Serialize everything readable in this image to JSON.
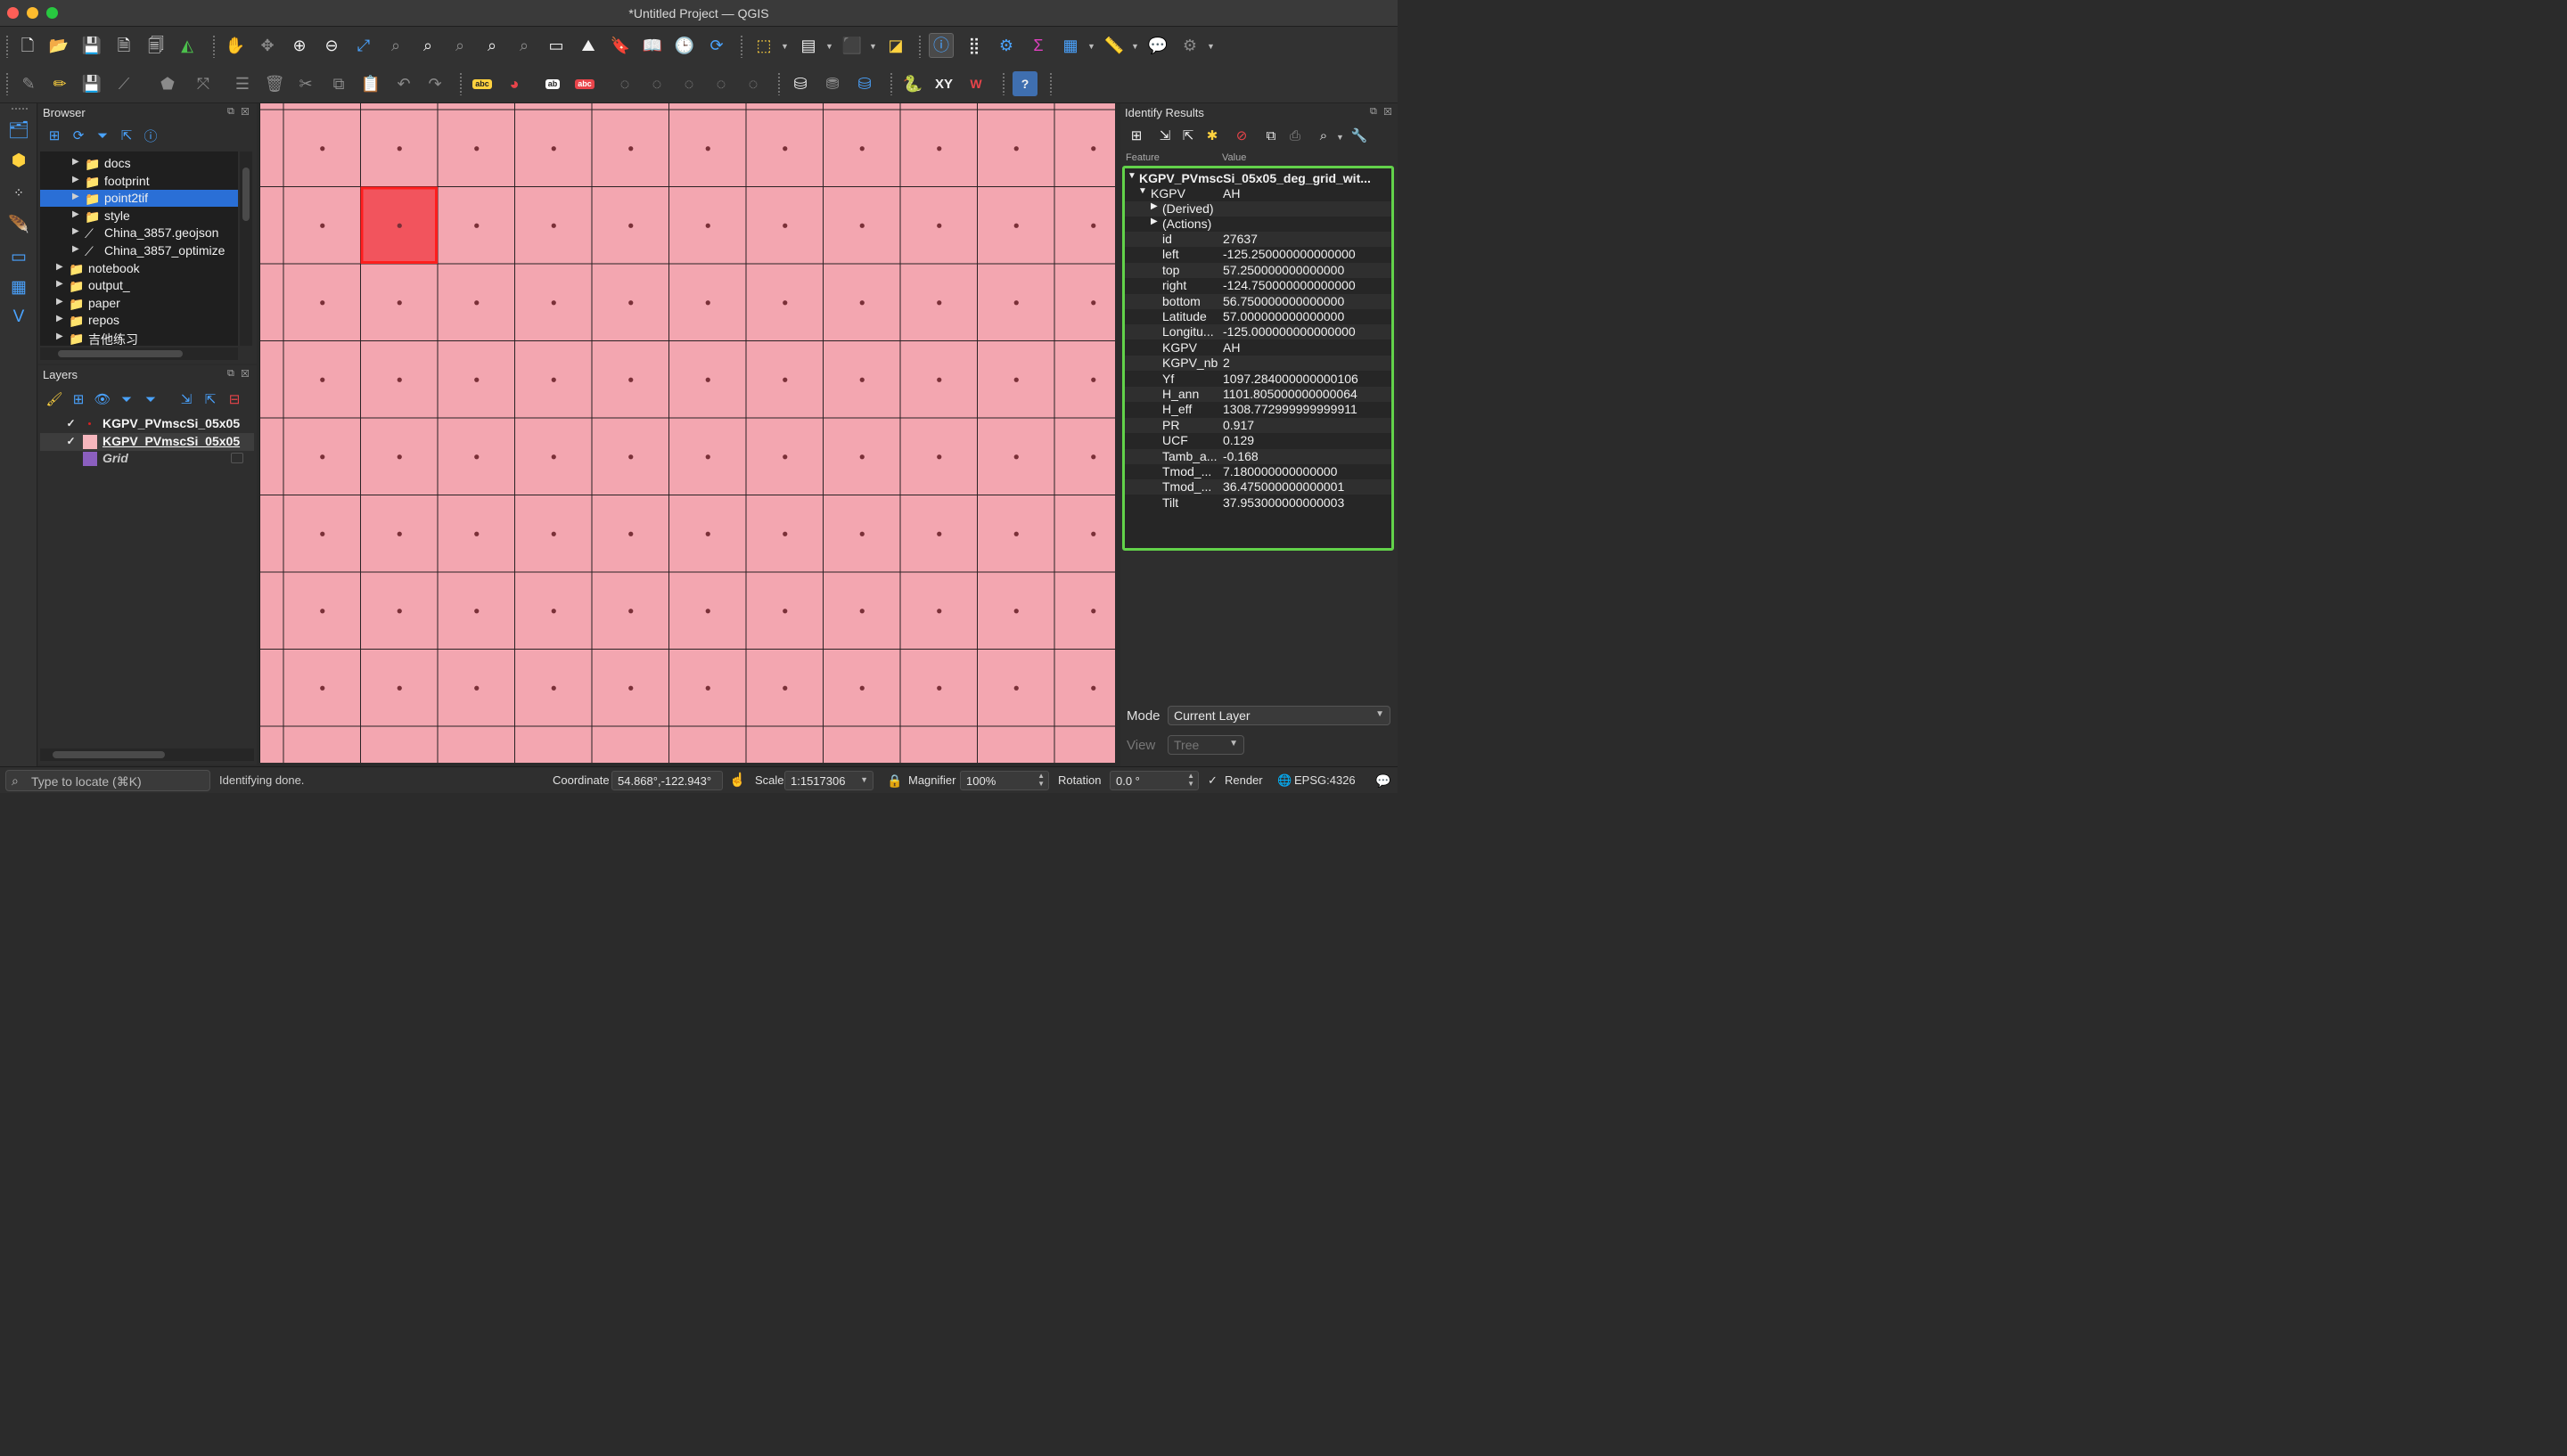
{
  "window": {
    "title": "*Untitled Project — QGIS"
  },
  "browser": {
    "title": "Browser",
    "items": [
      {
        "label": "docs",
        "icon": "folder-icon",
        "indent": 2,
        "selected": false
      },
      {
        "label": "footprint",
        "icon": "folder-icon",
        "indent": 2,
        "selected": false
      },
      {
        "label": "point2tif",
        "icon": "folder-icon",
        "indent": 2,
        "selected": true
      },
      {
        "label": "style",
        "icon": "folder-icon",
        "indent": 2,
        "selected": false
      },
      {
        "label": "China_3857.geojson",
        "icon": "vector-file-icon",
        "indent": 2,
        "selected": false
      },
      {
        "label": "China_3857_optimize",
        "icon": "vector-file-icon",
        "indent": 2,
        "selected": false
      },
      {
        "label": "notebook",
        "icon": "folder-icon",
        "indent": 1,
        "selected": false
      },
      {
        "label": "output_",
        "icon": "folder-icon",
        "indent": 1,
        "selected": false
      },
      {
        "label": "paper",
        "icon": "folder-icon",
        "indent": 1,
        "selected": false
      },
      {
        "label": "repos",
        "icon": "folder-icon",
        "indent": 1,
        "selected": false
      },
      {
        "label": "吉他练习",
        "icon": "folder-icon",
        "indent": 1,
        "selected": false
      }
    ]
  },
  "layers": {
    "title": "Layers",
    "items": [
      {
        "label": "KGPV_PVmscSi_05x05",
        "checked": true,
        "swatch": "point",
        "color": "#d62020",
        "italic": false,
        "selected": false
      },
      {
        "label": "KGPV_PVmscSi_05x05",
        "checked": true,
        "swatch": "polygon",
        "color": "#f5b6bd",
        "italic": false,
        "selected": true
      },
      {
        "label": "Grid",
        "checked": false,
        "swatch": "polygon",
        "color": "#8b5fbf",
        "italic": true,
        "selected": false
      }
    ]
  },
  "map": {
    "fill_color": "#f3a6b0",
    "highlight_color": "#f2545d",
    "highlight_border": "#ff1e1e",
    "grid_rows": 9,
    "grid_cols": 11,
    "highlight_cell": {
      "row": 1,
      "col": 1
    }
  },
  "identify": {
    "title": "Identify Results",
    "col_feature": "Feature",
    "col_value": "Value",
    "root": "KGPV_PVmscSi_05x05_deg_grid_wit...",
    "feature_key": "KGPV",
    "feature_value": "AH",
    "derived": "(Derived)",
    "actions": "(Actions)",
    "attributes": [
      {
        "key": "id",
        "value": "27637"
      },
      {
        "key": "left",
        "value": "-125.250000000000000"
      },
      {
        "key": "top",
        "value": "57.250000000000000"
      },
      {
        "key": "right",
        "value": "-124.750000000000000"
      },
      {
        "key": "bottom",
        "value": "56.750000000000000"
      },
      {
        "key": "Latitude",
        "value": "57.000000000000000"
      },
      {
        "key": "Longitu...",
        "value": "-125.000000000000000"
      },
      {
        "key": "KGPV",
        "value": "AH"
      },
      {
        "key": "KGPV_nb",
        "value": "2"
      },
      {
        "key": "Yf",
        "value": "1097.284000000000106"
      },
      {
        "key": "H_ann",
        "value": "1101.805000000000064"
      },
      {
        "key": "H_eff",
        "value": "1308.772999999999911"
      },
      {
        "key": "PR",
        "value": "0.917"
      },
      {
        "key": "UCF",
        "value": "0.129"
      },
      {
        "key": "Tamb_a...",
        "value": "-0.168"
      },
      {
        "key": "Tmod_...",
        "value": "7.180000000000000"
      },
      {
        "key": "Tmod_...",
        "value": "36.475000000000001"
      },
      {
        "key": "Tilt",
        "value": "37.953000000000003"
      }
    ],
    "mode_label": "Mode",
    "mode_value": "Current Layer",
    "view_label": "View",
    "view_value": "Tree"
  },
  "status": {
    "locator_placeholder": "Type to locate (⌘K)",
    "message": "Identifying done.",
    "coordinate_label": "Coordinate",
    "coordinate_value": "54.868°,-122.943°",
    "scale_label": "Scale",
    "scale_value": "1:1517306",
    "magnifier_label": "Magnifier",
    "magnifier_value": "100%",
    "rotation_label": "Rotation",
    "rotation_value": "0.0 °",
    "render_label": "Render",
    "crs": "EPSG:4326"
  }
}
